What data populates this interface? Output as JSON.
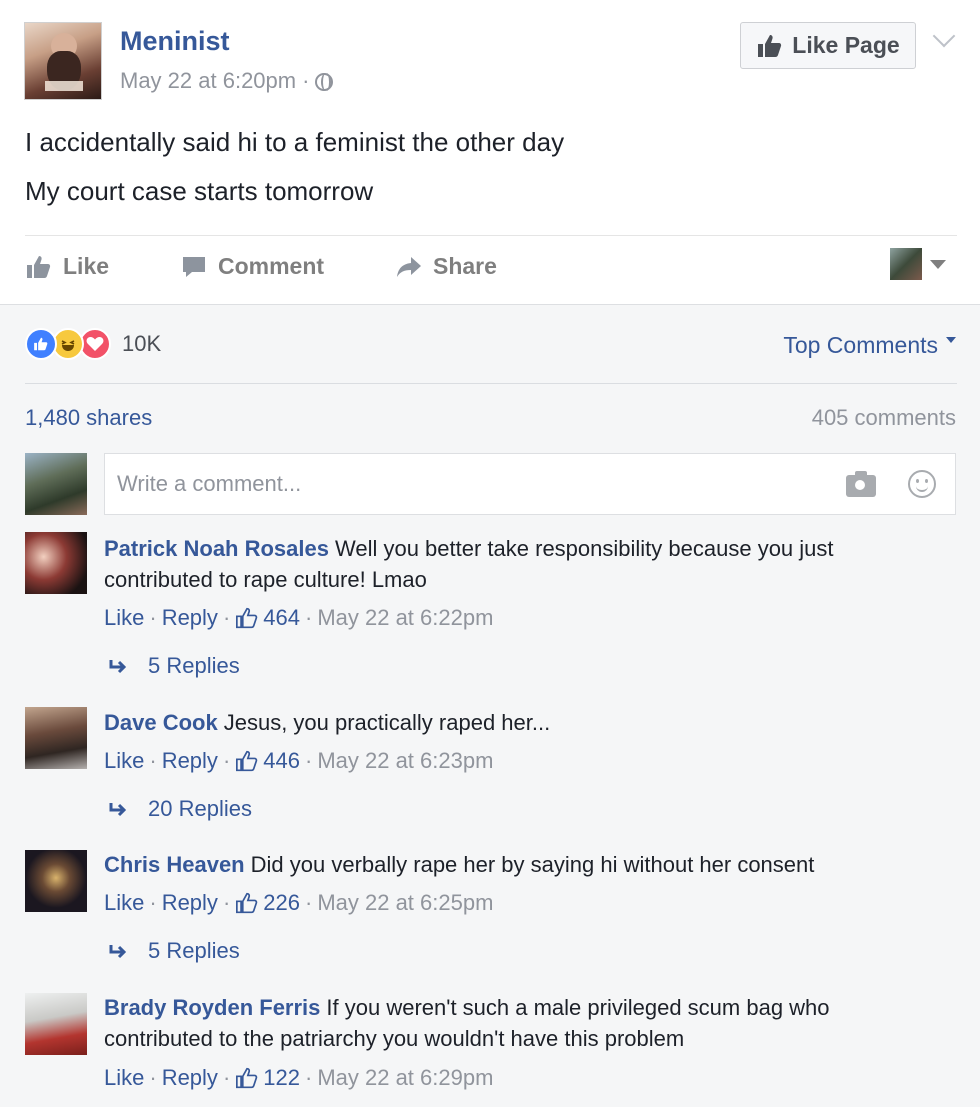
{
  "post": {
    "page_name": "Meninist",
    "timestamp": "May 22 at 6:20pm",
    "separator": "·",
    "like_page_label": "Like Page",
    "text_lines": [
      "I accidentally said hi to a feminist the other day",
      "My court case starts tomorrow"
    ]
  },
  "actions": {
    "like": "Like",
    "comment": "Comment",
    "share": "Share"
  },
  "summary": {
    "reaction_count": "10K",
    "sort_label": "Top Comments",
    "shares": "1,480 shares",
    "comments": "405 comments"
  },
  "composer": {
    "placeholder": "Write a comment..."
  },
  "comments": [
    {
      "author": "Patrick Noah Rosales",
      "text": "Well you better take responsibility because you just contributed to rape culture! Lmao",
      "like": "Like",
      "reply": "Reply",
      "likes": "464",
      "time": "May 22 at 6:22pm",
      "replies": "5 Replies"
    },
    {
      "author": "Dave Cook",
      "text": "Jesus, you practically raped her...",
      "like": "Like",
      "reply": "Reply",
      "likes": "446",
      "time": "May 22 at 6:23pm",
      "replies": "20 Replies"
    },
    {
      "author": "Chris Heaven",
      "text": "Did you verbally rape her by saying hi without her consent",
      "like": "Like",
      "reply": "Reply",
      "likes": "226",
      "time": "May 22 at 6:25pm",
      "replies": "5 Replies"
    },
    {
      "author": "Brady Royden Ferris",
      "text": "If you weren't such a male privileged scum bag who contributed to the patriarchy you wouldn't have this problem",
      "like": "Like",
      "reply": "Reply",
      "likes": "122",
      "time": "May 22 at 6:29pm"
    }
  ],
  "colors": {
    "link": "#365899",
    "meta": "#90949c",
    "background": "#f5f6f7",
    "like_reaction": "#4080ff",
    "haha_reaction": "#f7c93e",
    "love_reaction": "#f25268"
  },
  "icons": [
    "globe-icon",
    "thumbs-up-icon",
    "comment-icon",
    "share-icon",
    "camera-icon",
    "smiley-icon",
    "reply-arrow-icon",
    "chevron-down-icon"
  ]
}
